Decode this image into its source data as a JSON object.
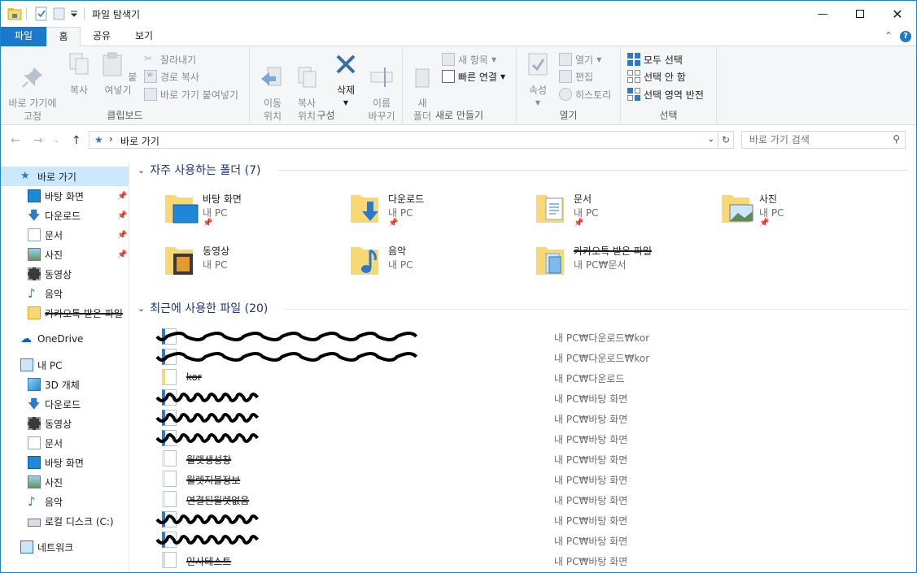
{
  "window": {
    "title": "파일 탐색기",
    "minimize_icon": "minimize-icon",
    "maximize_icon": "maximize-icon",
    "close_icon": "close-icon"
  },
  "ribbon_tabs": {
    "file": "파일",
    "home": "홈",
    "share": "공유",
    "view": "보기"
  },
  "ribbon": {
    "clipboard": {
      "label": "클립보드",
      "pin": "바로 가기에\n고정",
      "copy": "복사",
      "paste": "붙여넣기",
      "cut": "잘라내기",
      "copy_path": "경로 복사",
      "paste_shortcut": "바로 가기 붙여넣기"
    },
    "organize": {
      "label": "구성",
      "move_to": "이동\n위치",
      "copy_to": "복사\n위치",
      "delete": "삭제",
      "rename": "이름\n바꾸기"
    },
    "new": {
      "label": "새로 만들기",
      "new_folder": "새\n폴더",
      "new_item": "새 항목",
      "easy_access": "빠른 연결"
    },
    "open": {
      "label": "열기",
      "properties": "속성",
      "open": "열기",
      "edit": "편집",
      "history": "히스토리"
    },
    "select": {
      "label": "선택",
      "select_all": "모두 선택",
      "select_none": "선택 안 함",
      "invert": "선택 영역 반전"
    }
  },
  "address": {
    "path": "바로 가기",
    "search_placeholder": "바로 가기 검색"
  },
  "navpane": {
    "quick_access": "바로 가기",
    "quick_items": [
      "바탕 화면",
      "다운로드",
      "문서",
      "사진",
      "동영상",
      "음악",
      "카카오톡 받은 파일"
    ],
    "onedrive": "OneDrive",
    "this_pc": "내 PC",
    "pc_items": [
      "3D 개체",
      "다운로드",
      "동영상",
      "문서",
      "바탕 화면",
      "사진",
      "음악",
      "로컬 디스크 (C:)"
    ],
    "network": "네트워크"
  },
  "frequent": {
    "header": "자주 사용하는 폴더 (7)",
    "folders": [
      {
        "name": "바탕 화면",
        "location": "내 PC"
      },
      {
        "name": "다운로드",
        "location": "내 PC"
      },
      {
        "name": "문서",
        "location": "내 PC"
      },
      {
        "name": "사진",
        "location": "내 PC"
      },
      {
        "name": "동영상",
        "location": "내 PC"
      },
      {
        "name": "음악",
        "location": "내 PC"
      },
      {
        "name": "카카오톡 받은 파일",
        "location": "내 PC₩문서"
      }
    ]
  },
  "recent": {
    "header": "최근에 사용한 파일 (20)",
    "files": [
      {
        "name": "",
        "path": "내 PC₩다운로드₩kor"
      },
      {
        "name": "",
        "path": "내 PC₩다운로드₩kor"
      },
      {
        "name": "kor",
        "path": "내 PC₩다운로드"
      },
      {
        "name": "",
        "path": "내 PC₩바탕 화면"
      },
      {
        "name": "",
        "path": "내 PC₩바탕 화면"
      },
      {
        "name": "",
        "path": "내 PC₩바탕 화면"
      },
      {
        "name": "월랫생성창",
        "path": "내 PC₩바탕 화면"
      },
      {
        "name": "월렛지불정보",
        "path": "내 PC₩바탕 화면"
      },
      {
        "name": "연결된월렛없음",
        "path": "내 PC₩바탕 화면"
      },
      {
        "name": "",
        "path": "내 PC₩바탕 화면"
      },
      {
        "name": "",
        "path": "내 PC₩바탕 화면"
      },
      {
        "name": "인사테스트",
        "path": "내 PC₩바탕 화면"
      }
    ]
  },
  "colors": {
    "accent": "#1979ca",
    "selection": "#cce8ff",
    "section": "#1e3287"
  }
}
